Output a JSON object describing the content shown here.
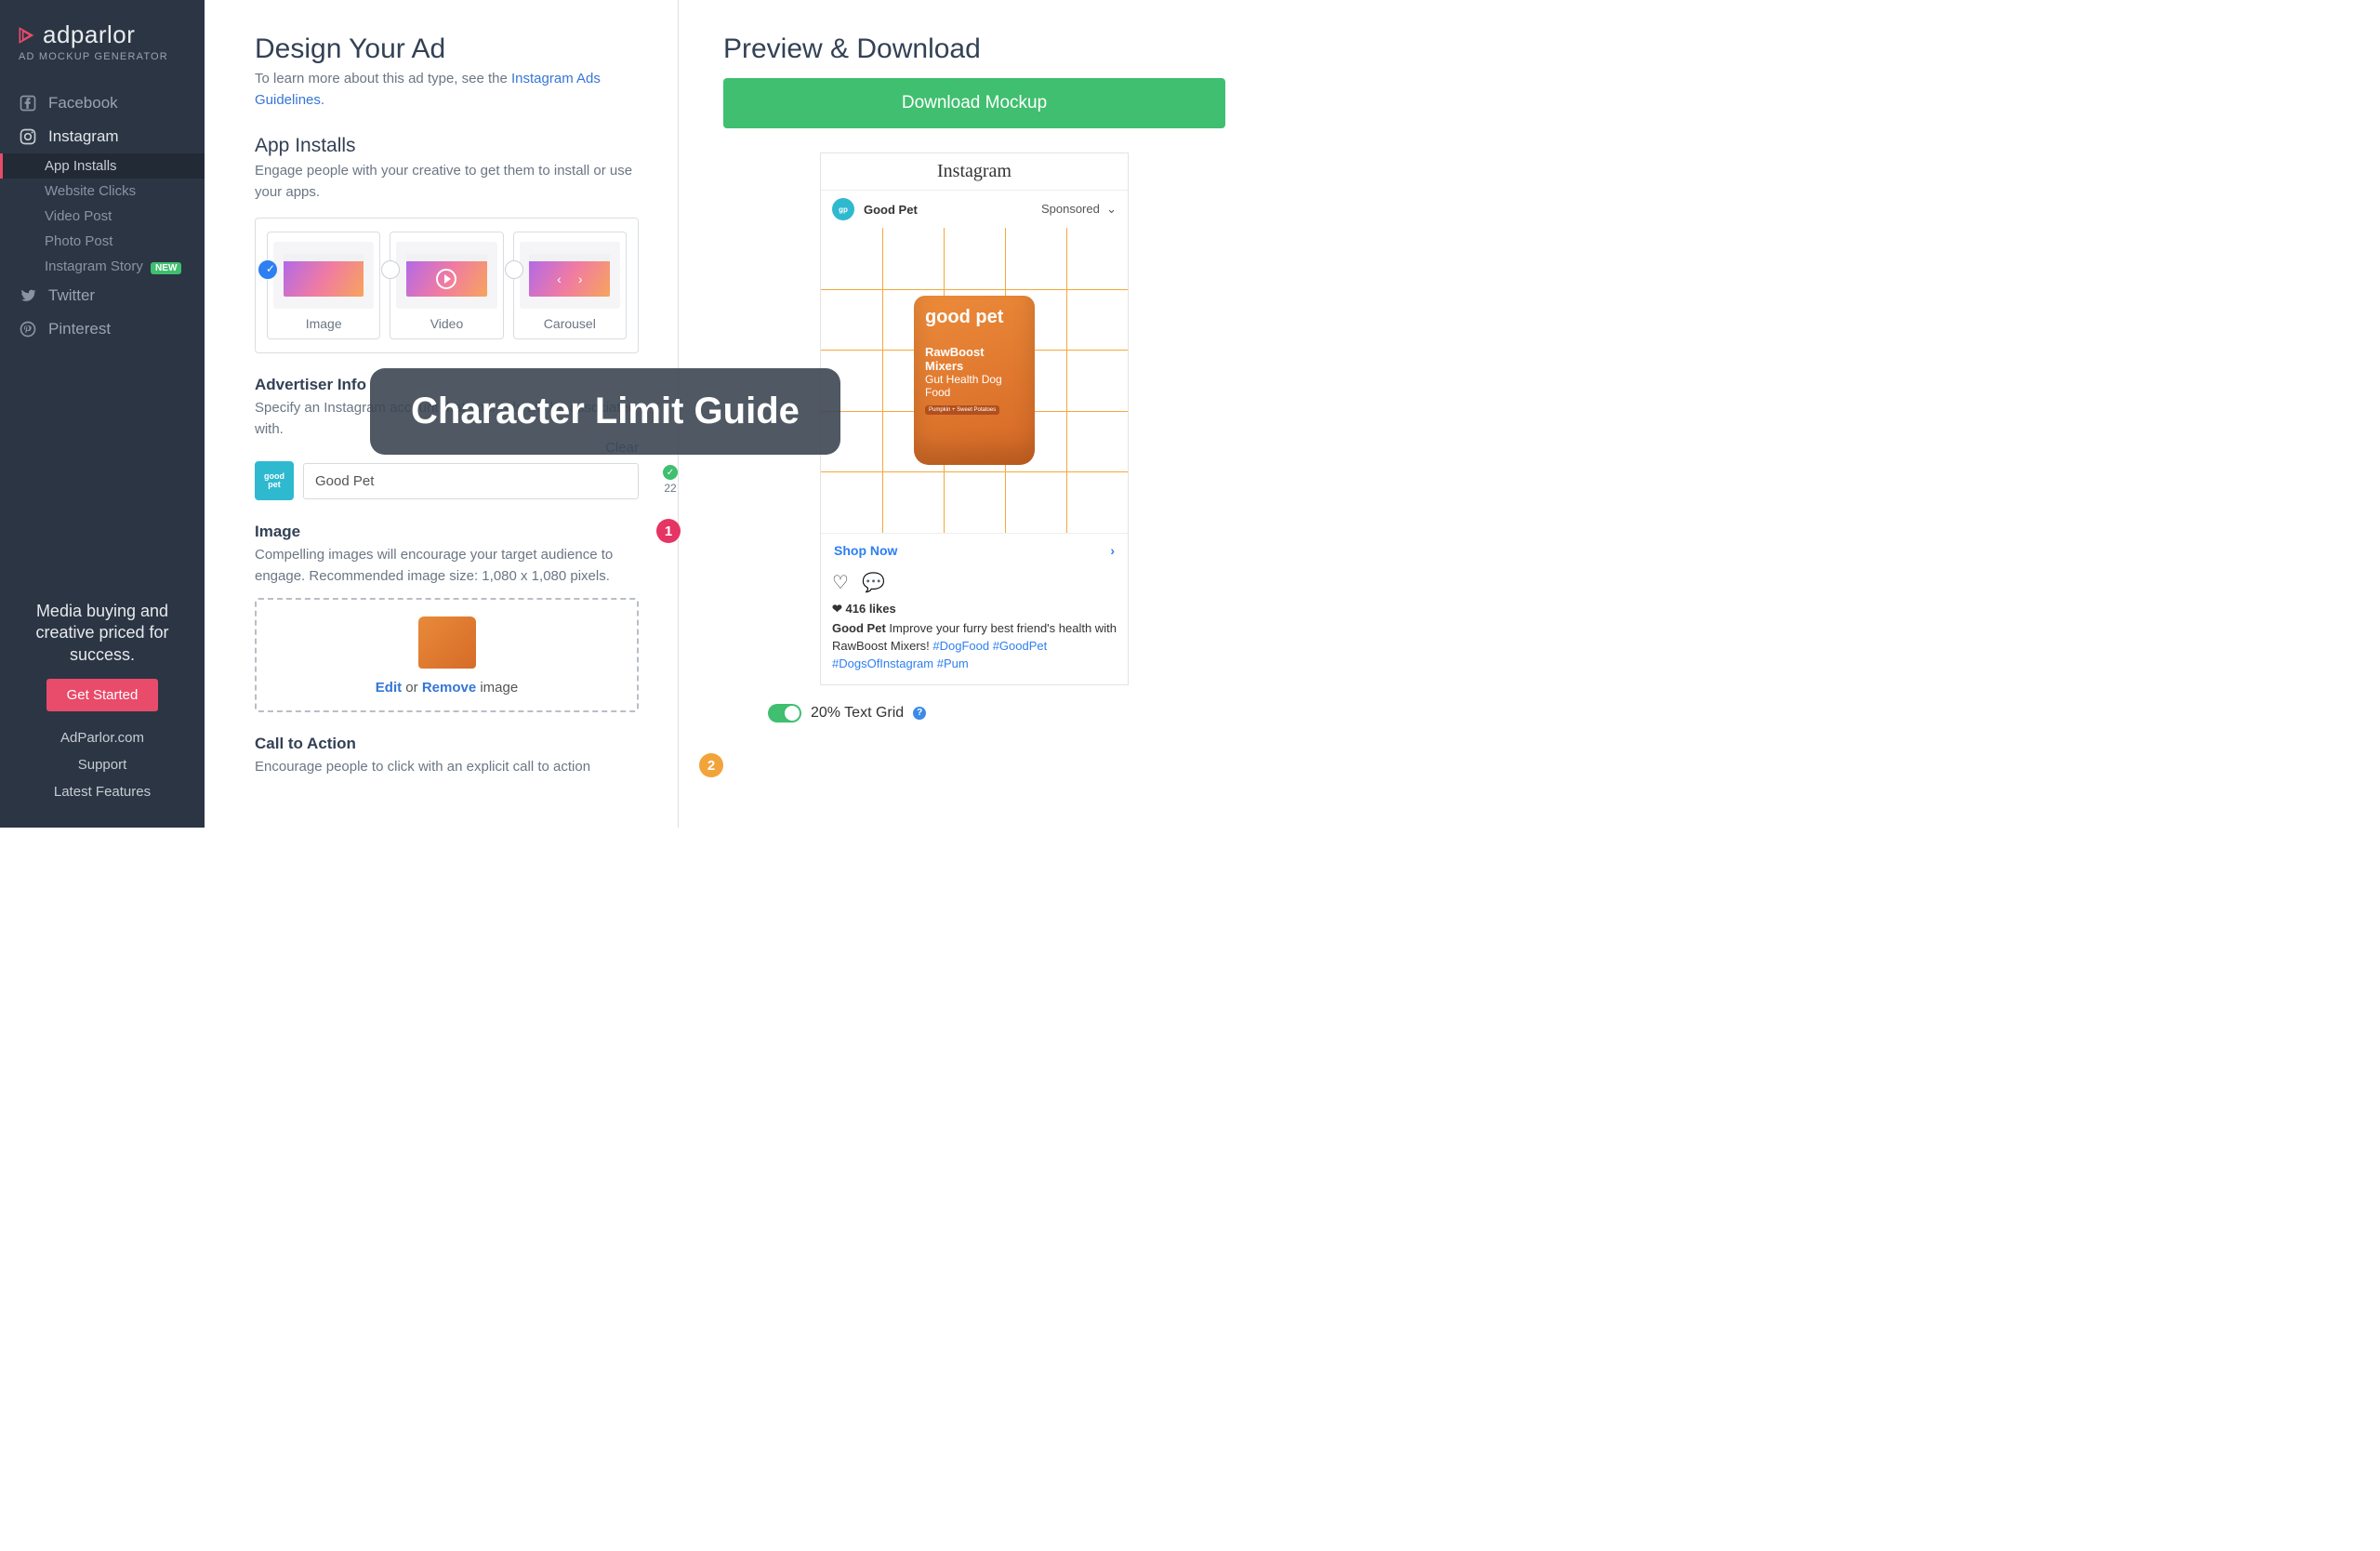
{
  "brand": {
    "name": "adparlor",
    "subtitle": "AD MOCKUP GENERATOR"
  },
  "nav": {
    "items": [
      {
        "label": "Facebook"
      },
      {
        "label": "Instagram"
      },
      {
        "label": "Twitter"
      },
      {
        "label": "Pinterest"
      }
    ],
    "instagram_sub": [
      "App Installs",
      "Website Clicks",
      "Video Post",
      "Photo Post",
      "Instagram Story"
    ],
    "new_badge": "NEW"
  },
  "sidebar_footer": {
    "pitch": "Media buying and creative priced for success.",
    "cta": "Get Started",
    "links": [
      "AdParlor.com",
      "Support",
      "Latest Features"
    ]
  },
  "design": {
    "title": "Design Your Ad",
    "intro_pre": "To learn more about this ad type, see the ",
    "intro_link": "Instagram Ads Guidelines",
    "section_title": "App Installs",
    "section_sub": "Engage people with your creative to get them to install or use your apps.",
    "types": [
      "Image",
      "Video",
      "Carousel"
    ],
    "advertiser": {
      "heading": "Advertiser Info",
      "sub": "Specify an Instagram account that your ads will be associated with.",
      "clear": "Clear",
      "value": "Good Pet",
      "count": "22"
    },
    "image": {
      "heading": "Image",
      "sub": "Compelling images will encourage your target audience to engage. Recommended image size: 1,080 x 1,080 pixels.",
      "edit": "Edit",
      "or": " or ",
      "remove": "Remove",
      "suffix": " image"
    },
    "cta": {
      "heading": "Call to Action",
      "sub": "Encourage people to click with an explicit call to action"
    }
  },
  "preview": {
    "title": "Preview & Download",
    "download": "Download Mockup",
    "ig_logo": "Instagram",
    "account": "Good Pet",
    "sponsored": "Sponsored",
    "cta_label": "Shop Now",
    "likes": "416 likes",
    "caption_user": "Good Pet",
    "caption_text": " Improve your furry best friend's health with RawBoost Mixers! ",
    "hashtags": "#DogFood #GoodPet #DogsOfInstagram #Pum",
    "pouch": {
      "brand": "good pet",
      "line1": "RawBoost Mixers",
      "line2": "Gut Health Dog Food",
      "strip": "Pumpkin + Sweet Potatoes"
    },
    "toggle_label": "20% Text Grid"
  },
  "overlay": {
    "banner": "Character Limit Guide",
    "n1": "1",
    "n2": "2"
  }
}
